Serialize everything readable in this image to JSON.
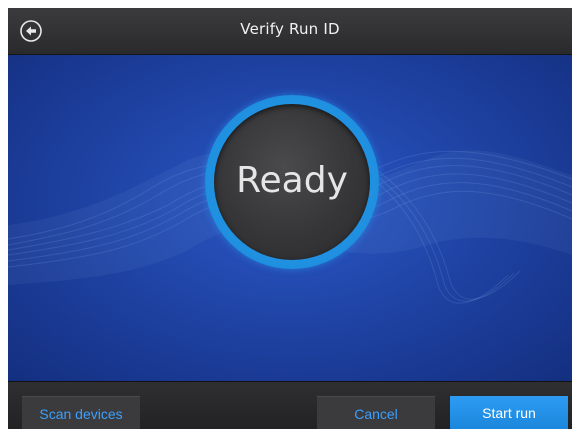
{
  "header": {
    "title": "Verify Run ID",
    "back_icon": "back-arrow-circle-icon"
  },
  "status": {
    "label": "Ready"
  },
  "footer": {
    "scan_label": "Scan devices",
    "cancel_label": "Cancel",
    "start_label": "Start run"
  },
  "colors": {
    "background_blue": "#2249ae",
    "ring_blue": "#1f8fe0",
    "accent_text": "#3aa0ff",
    "primary_button": "#1a86dc",
    "bar_dark": "#2a2a2c"
  }
}
